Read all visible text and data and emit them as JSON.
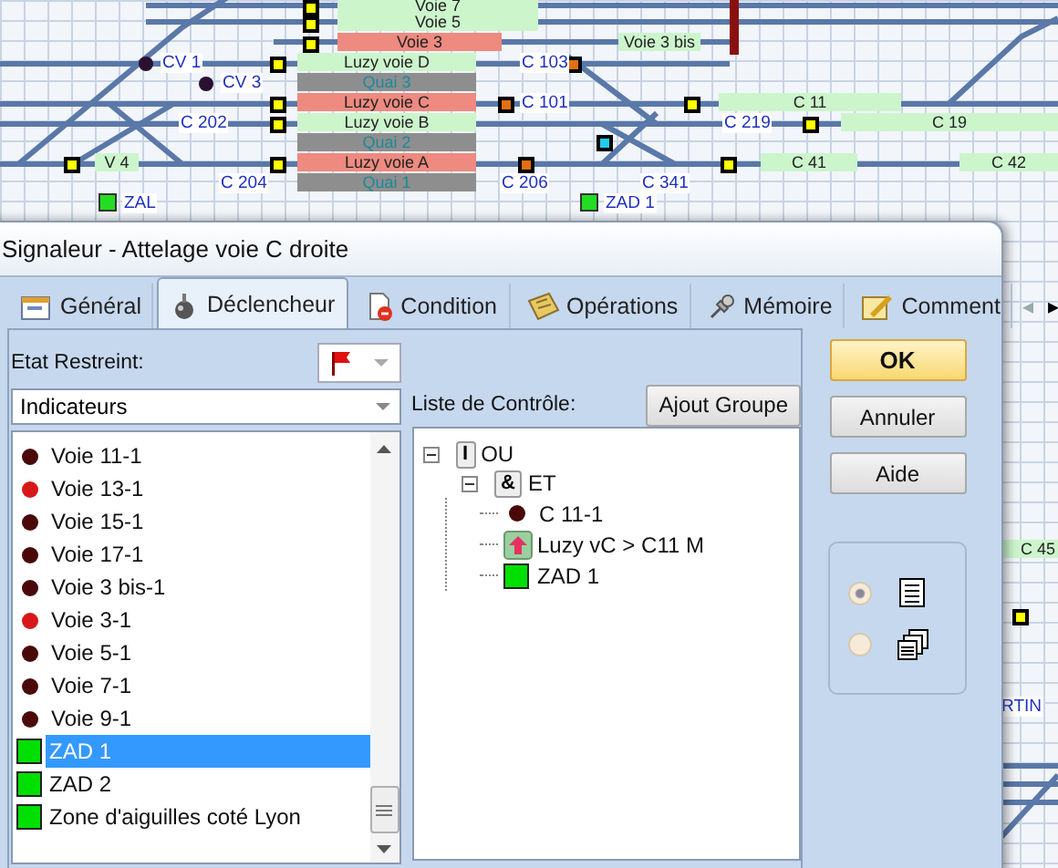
{
  "diagram": {
    "blocks": [
      {
        "label": "Voie 7",
        "kind": "free"
      },
      {
        "label": "Voie 5",
        "kind": "free"
      },
      {
        "label": "Voie 3",
        "kind": "occupied"
      },
      {
        "label": "Voie 3 bis",
        "kind": "free"
      },
      {
        "label": "Luzy voie D",
        "kind": "free"
      },
      {
        "label": "Quai 3",
        "kind": "platform"
      },
      {
        "label": "Luzy voie C",
        "kind": "occupied"
      },
      {
        "label": "C 11",
        "kind": "free"
      },
      {
        "label": "Luzy voie B",
        "kind": "free"
      },
      {
        "label": "C 19",
        "kind": "free"
      },
      {
        "label": "Quai 2",
        "kind": "platform"
      },
      {
        "label": "V 4",
        "kind": "free"
      },
      {
        "label": "Luzy voie A",
        "kind": "occupied"
      },
      {
        "label": "C 41",
        "kind": "free"
      },
      {
        "label": "C 42",
        "kind": "free"
      },
      {
        "label": "Quai 1",
        "kind": "platform"
      },
      {
        "label": "C 45",
        "kind": "free"
      }
    ],
    "labels": [
      "CV 1",
      "C 103",
      "CV 3",
      "C 101",
      "C 202",
      "C 219",
      "C 204",
      "C 206",
      "C 341",
      "RTIN"
    ],
    "zones": [
      {
        "label": "ZAL",
        "color": "#22dd22"
      },
      {
        "label": "ZAD 1",
        "color": "#22dd22"
      }
    ]
  },
  "dialog": {
    "title": "Signaleur - Attelage voie C  droite",
    "tabs": [
      {
        "label": "Général",
        "selected": false
      },
      {
        "label": "Déclencheur",
        "selected": true
      },
      {
        "label": "Condition",
        "selected": false
      },
      {
        "label": "Opérations",
        "selected": false
      },
      {
        "label": "Mémoire",
        "selected": false
      },
      {
        "label": "Comment",
        "selected": false
      }
    ],
    "tab_scroll": [
      {
        "label": "◂",
        "disabled": true
      },
      {
        "label": "▸",
        "disabled": false
      }
    ],
    "restricted_state": {
      "label": "Etat Restreint:"
    },
    "category": {
      "value": "Indicateurs"
    },
    "items": [
      {
        "label": "Voie 11-1",
        "kind": "dot",
        "color": "#4a0808",
        "selected": false
      },
      {
        "label": "Voie 13-1",
        "kind": "dot",
        "color": "#d81818",
        "selected": false
      },
      {
        "label": "Voie 15-1",
        "kind": "dot",
        "color": "#4a0808",
        "selected": false
      },
      {
        "label": "Voie 17-1",
        "kind": "dot",
        "color": "#4a0808",
        "selected": false
      },
      {
        "label": "Voie 3 bis-1",
        "kind": "dot",
        "color": "#4a0808",
        "selected": false
      },
      {
        "label": "Voie 3-1",
        "kind": "dot",
        "color": "#d81818",
        "selected": false
      },
      {
        "label": "Voie 5-1",
        "kind": "dot",
        "color": "#4a0808",
        "selected": false
      },
      {
        "label": "Voie 7-1",
        "kind": "dot",
        "color": "#4a0808",
        "selected": false
      },
      {
        "label": "Voie 9-1",
        "kind": "dot",
        "color": "#4a0808",
        "selected": false
      },
      {
        "label": "ZAD 1",
        "kind": "square",
        "color": "#00e000",
        "selected": true
      },
      {
        "label": "ZAD 2",
        "kind": "square",
        "color": "#00e000",
        "selected": false
      },
      {
        "label": "Zone d'aiguilles coté Lyon",
        "kind": "square",
        "color": "#00e000",
        "selected": false
      }
    ],
    "control_list": {
      "label": "Liste de Contrôle:",
      "add_group": "Ajout Groupe",
      "tree": [
        {
          "kind": "group",
          "symbol": "I",
          "label": "OU",
          "expanded": true,
          "children": [
            {
              "kind": "group",
              "symbol": "&",
              "label": "ET",
              "expanded": true,
              "children": [
                {
                  "kind": "dot",
                  "color": "#4a0808",
                  "label": "C 11-1"
                },
                {
                  "kind": "route",
                  "label": "Luzy vC > C11 M"
                },
                {
                  "kind": "square",
                  "color": "#00e000",
                  "label": "ZAD 1"
                }
              ]
            }
          ]
        }
      ]
    },
    "buttons": [
      {
        "label": "OK",
        "kind": "default"
      },
      {
        "label": "Annuler",
        "kind": "normal"
      },
      {
        "label": "Aide",
        "kind": "normal"
      }
    ],
    "view_options": [
      {
        "kind": "list",
        "selected": true
      },
      {
        "kind": "cascade",
        "selected": false
      }
    ]
  }
}
